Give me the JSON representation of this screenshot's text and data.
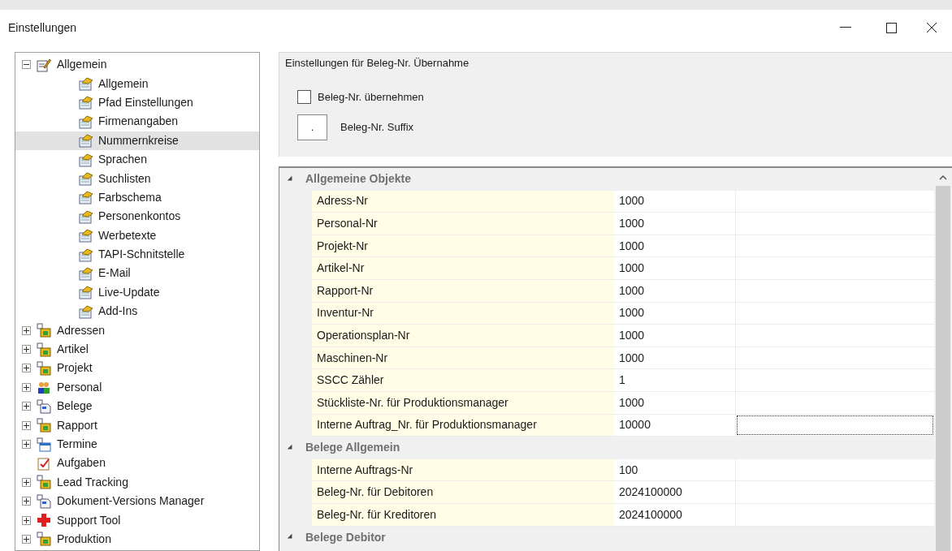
{
  "window": {
    "title": "Einstellungen"
  },
  "tree": [
    {
      "label": "Allgemein",
      "kind": "settings",
      "expanded": true,
      "selected": false,
      "children": [
        {
          "label": "Allgemein",
          "selected": false
        },
        {
          "label": "Pfad Einstellungen",
          "selected": false
        },
        {
          "label": "Firmenangaben",
          "selected": false
        },
        {
          "label": "Nummernkreise",
          "selected": true
        },
        {
          "label": "Sprachen",
          "selected": false
        },
        {
          "label": "Suchlisten",
          "selected": false
        },
        {
          "label": "Farbschema",
          "selected": false
        },
        {
          "label": "Personenkontos",
          "selected": false
        },
        {
          "label": "Werbetexte",
          "selected": false
        },
        {
          "label": "TAPI-Schnitstelle",
          "selected": false
        },
        {
          "label": "E-Mail",
          "selected": false
        },
        {
          "label": "Live-Update",
          "selected": false
        },
        {
          "label": "Add-Ins",
          "selected": false
        }
      ]
    },
    {
      "label": "Adressen",
      "kind": "module",
      "expanded": false,
      "selected": false
    },
    {
      "label": "Artikel",
      "kind": "module",
      "expanded": false,
      "selected": false
    },
    {
      "label": "Projekt",
      "kind": "module",
      "expanded": false,
      "selected": false
    },
    {
      "label": "Personal",
      "kind": "people",
      "expanded": false,
      "selected": false
    },
    {
      "label": "Belege",
      "kind": "document",
      "expanded": false,
      "selected": false
    },
    {
      "label": "Rapport",
      "kind": "module",
      "expanded": false,
      "selected": false
    },
    {
      "label": "Termine",
      "kind": "calendar",
      "expanded": false,
      "selected": false
    },
    {
      "label": "Aufgaben",
      "kind": "task",
      "selected": false
    },
    {
      "label": "Lead Tracking",
      "kind": "module",
      "expanded": false,
      "selected": false
    },
    {
      "label": "Dokument-Versions Manager",
      "kind": "document",
      "expanded": false,
      "selected": false
    },
    {
      "label": "Support Tool",
      "kind": "support",
      "expanded": false,
      "selected": false
    },
    {
      "label": "Produktion",
      "kind": "module",
      "expanded": false,
      "selected": false
    }
  ],
  "group": {
    "title": "Einstellungen für Beleg-Nr. Übernahme",
    "checkbox": {
      "label": "Beleg-Nr. übernehmen",
      "checked": false
    },
    "suffix": {
      "value": ".",
      "label": "Beleg-Nr. Suffix"
    }
  },
  "grid": [
    {
      "category": "Allgemeine Objekte",
      "expanded": true,
      "rows": [
        {
          "name": "Adress-Nr",
          "value": "1000",
          "focused": false
        },
        {
          "name": "Personal-Nr",
          "value": "1000",
          "focused": false
        },
        {
          "name": "Projekt-Nr",
          "value": "1000",
          "focused": false
        },
        {
          "name": "Artikel-Nr",
          "value": "1000",
          "focused": false
        },
        {
          "name": "Rapport-Nr",
          "value": "1000",
          "focused": false
        },
        {
          "name": "Inventur-Nr",
          "value": "1000",
          "focused": false
        },
        {
          "name": "Operationsplan-Nr",
          "value": "1000",
          "focused": false
        },
        {
          "name": "Maschinen-Nr",
          "value": "1000",
          "focused": false
        },
        {
          "name": "SSCC Zähler",
          "value": "1",
          "focused": false
        },
        {
          "name": "Stückliste-Nr. für Produktionsmanager",
          "value": "1000",
          "focused": false
        },
        {
          "name": "Interne Auftrag_Nr. für Produktionsmanager",
          "value": "10000",
          "focused": true
        }
      ]
    },
    {
      "category": "Belege Allgemein",
      "expanded": true,
      "rows": [
        {
          "name": "Interne Auftrags-Nr",
          "value": "100",
          "focused": false
        },
        {
          "name": "Beleg-Nr. für Debitoren",
          "value": "2024100000",
          "focused": false
        },
        {
          "name": "Beleg-Nr. für Kreditoren",
          "value": "2024100000",
          "focused": false
        }
      ]
    },
    {
      "category": "Belege Debitor",
      "expanded": true
    }
  ]
}
